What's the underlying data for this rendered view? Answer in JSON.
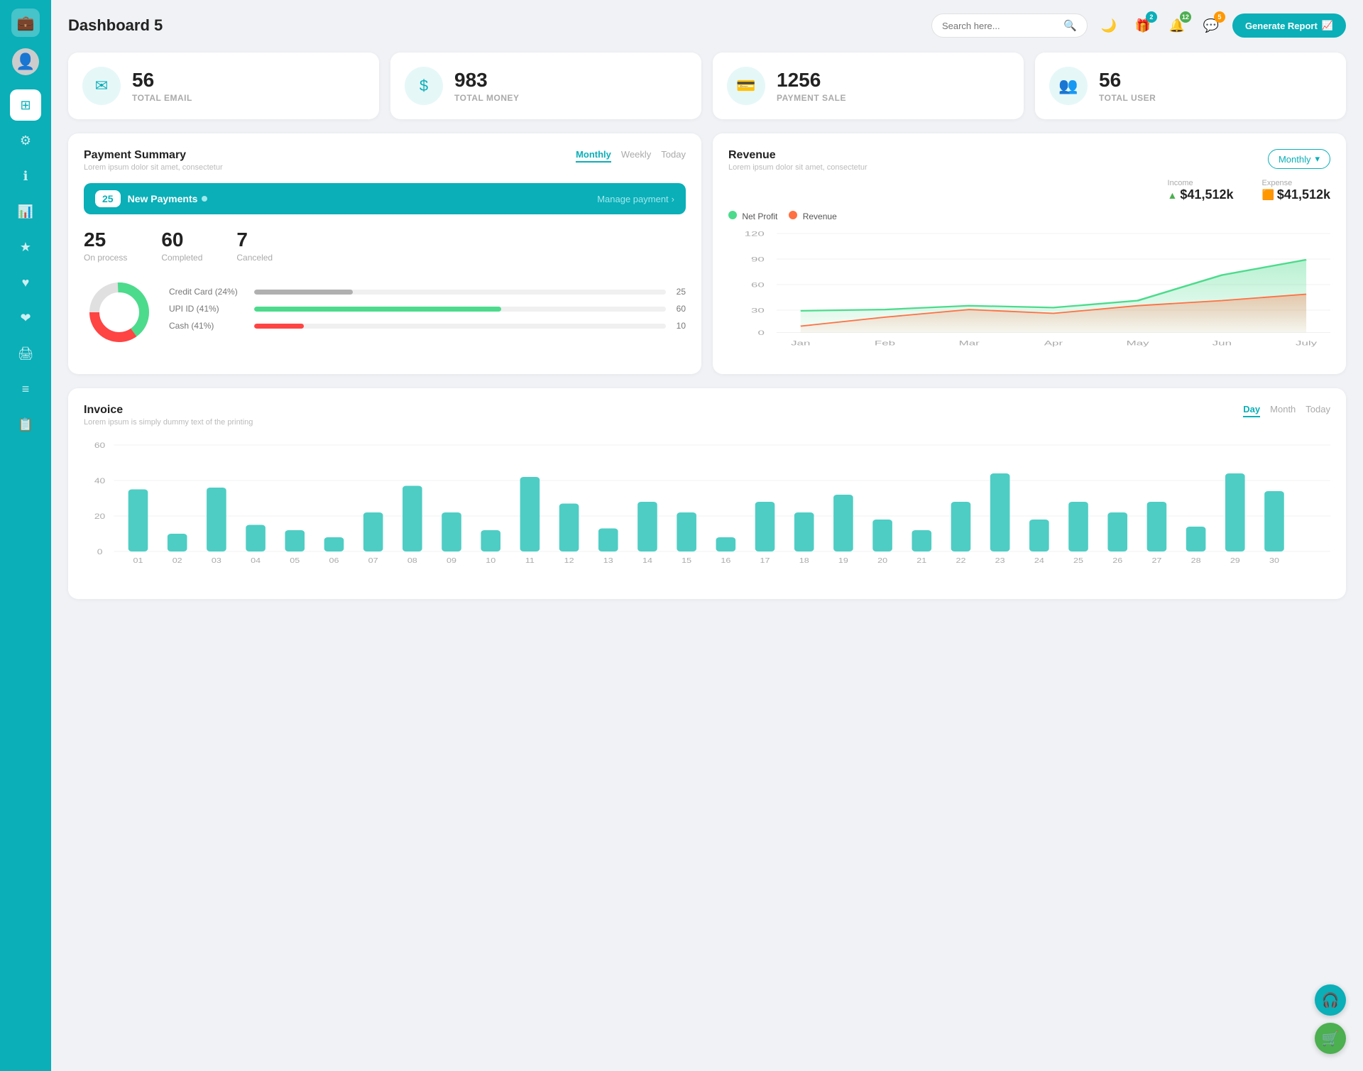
{
  "app": {
    "title": "Dashboard 5"
  },
  "topbar": {
    "search_placeholder": "Search here...",
    "generate_btn_label": "Generate Report",
    "badge_count_1": "2",
    "badge_count_2": "12",
    "badge_count_3": "5"
  },
  "stats": [
    {
      "id": "total-email",
      "value": "56",
      "label": "TOTAL EMAIL",
      "icon": "✉"
    },
    {
      "id": "total-money",
      "value": "983",
      "label": "TOTAL MONEY",
      "icon": "$"
    },
    {
      "id": "payment-sale",
      "value": "1256",
      "label": "PAYMENT SALE",
      "icon": "💳"
    },
    {
      "id": "total-user",
      "value": "56",
      "label": "TOTAL USER",
      "icon": "👥"
    }
  ],
  "payment_summary": {
    "title": "Payment Summary",
    "subtitle": "Lorem ipsum dolor sit amet, consectetur",
    "tabs": [
      "Monthly",
      "Weekly",
      "Today"
    ],
    "active_tab": "Monthly",
    "new_payments_count": "25",
    "new_payments_label": "New Payments",
    "manage_link": "Manage payment",
    "on_process": "25",
    "on_process_label": "On process",
    "completed": "60",
    "completed_label": "Completed",
    "canceled": "7",
    "canceled_label": "Canceled",
    "progress_items": [
      {
        "label": "Credit Card (24%)",
        "value": 24,
        "color": "#b0b0b0",
        "count": "25"
      },
      {
        "label": "UPI ID (41%)",
        "value": 60,
        "color": "#4cdb8c",
        "count": "60"
      },
      {
        "label": "Cash (41%)",
        "value": 12,
        "color": "#ff4444",
        "count": "10"
      }
    ]
  },
  "revenue": {
    "title": "Revenue",
    "subtitle": "Lorem ipsum dolor sit amet, consectetur",
    "dropdown_label": "Monthly",
    "income_label": "Income",
    "income_value": "$41,512k",
    "expense_label": "Expense",
    "expense_value": "$41,512k",
    "legend": [
      {
        "label": "Net Profit",
        "color": "#4cdb8c"
      },
      {
        "label": "Revenue",
        "color": "#ff7043"
      }
    ],
    "x_labels": [
      "Jan",
      "Feb",
      "Mar",
      "Apr",
      "May",
      "Jun",
      "July"
    ],
    "y_labels": [
      "0",
      "30",
      "60",
      "90",
      "120"
    ],
    "net_profit_data": [
      28,
      30,
      35,
      32,
      42,
      75,
      95
    ],
    "revenue_data": [
      8,
      20,
      30,
      25,
      35,
      42,
      50
    ]
  },
  "invoice": {
    "title": "Invoice",
    "subtitle": "Lorem ipsum is simply dummy text of the printing",
    "tabs": [
      "Day",
      "Month",
      "Today"
    ],
    "active_tab": "Day",
    "y_labels": [
      "0",
      "20",
      "40",
      "60"
    ],
    "x_labels": [
      "01",
      "02",
      "03",
      "04",
      "05",
      "06",
      "07",
      "08",
      "09",
      "10",
      "11",
      "12",
      "13",
      "14",
      "15",
      "16",
      "17",
      "18",
      "19",
      "20",
      "21",
      "22",
      "23",
      "24",
      "25",
      "26",
      "27",
      "28",
      "29",
      "30"
    ],
    "bar_data": [
      35,
      10,
      36,
      15,
      12,
      8,
      22,
      37,
      22,
      12,
      42,
      27,
      13,
      28,
      22,
      8,
      28,
      22,
      32,
      18,
      12,
      28,
      44,
      18,
      28,
      22,
      28,
      14,
      44,
      34
    ]
  },
  "sidebar": {
    "items": [
      {
        "id": "wallet",
        "icon": "💼",
        "active": true
      },
      {
        "id": "dashboard",
        "icon": "⊞",
        "active": false
      },
      {
        "id": "settings",
        "icon": "⚙",
        "active": false
      },
      {
        "id": "info",
        "icon": "ℹ",
        "active": false
      },
      {
        "id": "chart",
        "icon": "📊",
        "active": false
      },
      {
        "id": "star",
        "icon": "★",
        "active": false
      },
      {
        "id": "heart",
        "icon": "♥",
        "active": false
      },
      {
        "id": "heart2",
        "icon": "❤",
        "active": false
      },
      {
        "id": "print",
        "icon": "🖨",
        "active": false
      },
      {
        "id": "list",
        "icon": "≡",
        "active": false
      },
      {
        "id": "doc",
        "icon": "📋",
        "active": false
      }
    ]
  },
  "float_btns": [
    {
      "id": "headset",
      "icon": "🎧",
      "color": "#0aafb8"
    },
    {
      "id": "cart",
      "icon": "🛒",
      "color": "#4caf50"
    }
  ]
}
